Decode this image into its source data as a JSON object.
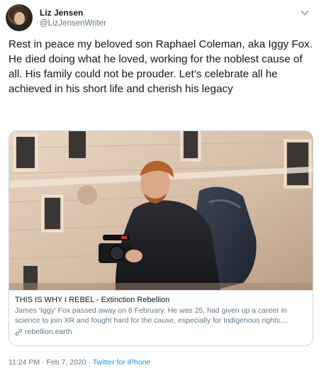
{
  "author": {
    "name": "Liz Jensen",
    "handle": "@LizJensenWriter"
  },
  "tweet": {
    "text": "Rest in peace my beloved son Raphael Coleman, aka Iggy Fox. He died doing what he loved, working for the noblest cause of all. His family could not be prouder. Let’s celebrate all he achieved in his short life and cherish his legacy"
  },
  "card": {
    "title": "THIS IS WHY I REBEL - Extinction Rebellion",
    "description": "James 'Iggy' Fox passed away on 6 February. He was 25, had given up a career in science to join XR and fought hard for the cause, especially for Indigenous rights....",
    "domain": "rebellion.earth"
  },
  "footer": {
    "timestamp": "11:24 PM · Feb 7, 2020 · ",
    "source": "Twitter for iPhone"
  },
  "icons": {
    "caret": "chevron-down-icon",
    "link": "link-icon"
  },
  "colors": {
    "link_blue": "#1b95e0",
    "secondary_text": "#657786"
  }
}
